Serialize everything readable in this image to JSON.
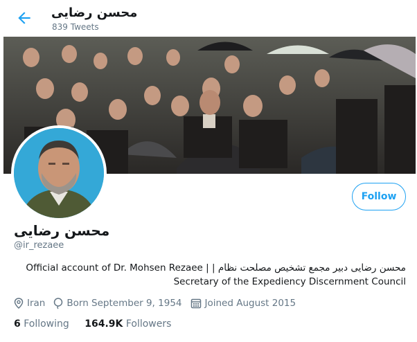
{
  "header": {
    "name": "محسن رضایی",
    "tweet_count": "839 Tweets",
    "back_icon": "arrow-left-icon"
  },
  "profile": {
    "name": "محسن رضایی",
    "handle": "@ir_rezaee",
    "bio_line1": "Official account of Dr. Mohsen Rezaee | | محسن رضایی دبیر مجمع تشخیص مصلحت نظام",
    "bio_line2": "Secretary of the Expediency Discernment Council",
    "location": "Iran",
    "born": "Born September 9, 1954",
    "joined": "Joined August 2015",
    "follow_label": "Follow"
  },
  "stats": {
    "following_count": "6",
    "following_label": "Following",
    "followers_count": "164.9K",
    "followers_label": "Followers"
  },
  "colors": {
    "accent": "#1da1f2",
    "secondary_text": "#657786",
    "avatar_bg": "#34a8d7"
  }
}
